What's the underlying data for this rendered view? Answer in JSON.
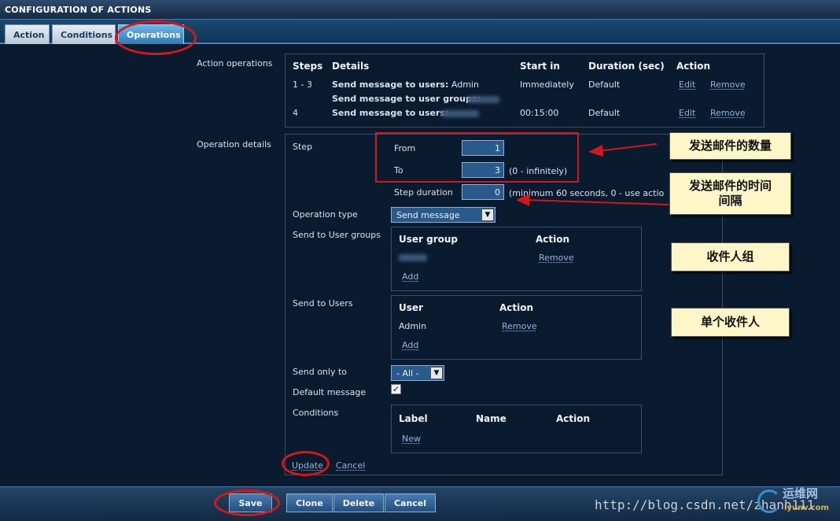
{
  "window": {
    "title": "CONFIGURATION OF ACTIONS"
  },
  "tabs": [
    {
      "label": "Action"
    },
    {
      "label": "Conditions"
    },
    {
      "label": "Operations"
    }
  ],
  "action_operations": {
    "section_label": "Action operations",
    "headers": [
      "Steps",
      "Details",
      "Start in",
      "Duration (sec)",
      "Action"
    ],
    "rows": [
      {
        "steps": "1 - 3",
        "detail1_label": "Send message to users:",
        "detail1_value": "Admin",
        "detail2_label": "Send message to user groups:",
        "start_in": "Immediately",
        "duration": "Default",
        "edit": "Edit",
        "remove": "Remove"
      },
      {
        "steps": "4",
        "detail1_label": "Send message to users:",
        "start_in": "00:15:00",
        "duration": "Default",
        "edit": "Edit",
        "remove": "Remove"
      }
    ]
  },
  "operation_details": {
    "section_label": "Operation details",
    "step_label": "Step",
    "from_label": "From",
    "from_value": "1",
    "to_label": "To",
    "to_value": "3",
    "to_hint": "(0 - infinitely)",
    "step_duration_label": "Step duration",
    "step_duration_value": "0",
    "step_duration_hint": "(minimum 60 seconds, 0 - use actio",
    "operation_type_label": "Operation type",
    "operation_type_value": "Send message",
    "send_to_groups_label": "Send to User groups",
    "groups_headers": [
      "User group",
      "Action"
    ],
    "groups_remove": "Remove",
    "groups_add": "Add",
    "send_to_users_label": "Send to Users",
    "users_headers": [
      "User",
      "Action"
    ],
    "users_rows": [
      {
        "user": "Admin",
        "action": "Remove"
      }
    ],
    "users_add": "Add",
    "send_only_to_label": "Send only to",
    "send_only_to_value": "- All -",
    "default_message_label": "Default message",
    "default_message_checked": true,
    "conditions_label": "Conditions",
    "conditions_headers": [
      "Label",
      "Name",
      "Action"
    ],
    "conditions_new": "New",
    "update": "Update",
    "cancel": "Cancel"
  },
  "annotations": {
    "note_count": "发送邮件的数量",
    "note_interval": "发送邮件的时间间隔",
    "note_groups": "收件人组",
    "note_single": "单个收件人",
    "color": "#d21818"
  },
  "footer": {
    "save": "Save",
    "clone": "Clone",
    "delete": "Delete",
    "cancel": "Cancel"
  },
  "watermark": {
    "url": "http://blog.csdn.net/zhanh111",
    "logo_text": "运维网",
    "logo_sub": "iyunv.com"
  },
  "colors": {
    "background": "#0b1b2f",
    "link": "#8fb4dc",
    "accent": "#2e7ab6",
    "annotation": "#d21818",
    "note_bg": "#fdf6c8"
  }
}
